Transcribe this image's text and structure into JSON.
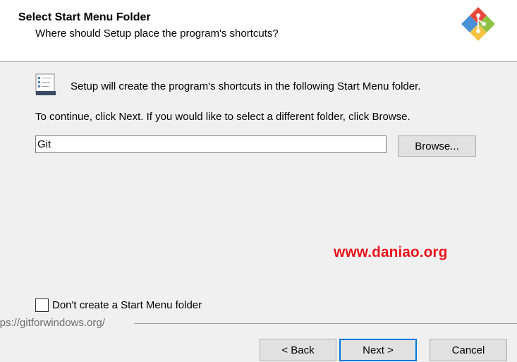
{
  "header": {
    "title": "Select Start Menu Folder",
    "subtitle": "Where should Setup place the program's shortcuts?",
    "logo_icon": "git-logo-icon"
  },
  "body": {
    "folder_icon": "start-menu-folder-icon",
    "intro": "Setup will create the program's shortcuts in the following Start Menu folder.",
    "instruction": "To continue, click Next. If you would like to select a different folder, click Browse.",
    "folder_value": "Git",
    "browse_label": "Browse...",
    "watermark": "www.daniao.org",
    "no_folder_checkbox": {
      "label": "Don't create a Start Menu folder",
      "checked": false
    }
  },
  "footer": {
    "url": "https://gitforwindows.org/",
    "back_label": "< Back",
    "next_label": "Next >",
    "cancel_label": "Cancel"
  },
  "colors": {
    "accent": "#0078d7",
    "watermark": "#e8121a",
    "background": "#f0f0f0"
  }
}
